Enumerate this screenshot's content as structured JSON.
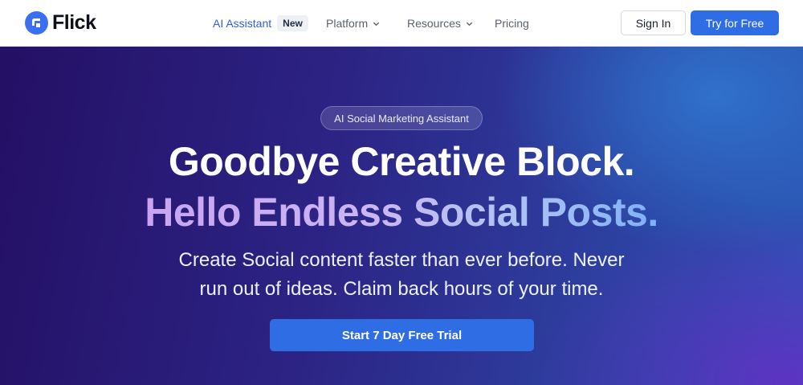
{
  "brand": {
    "name": "Flick",
    "icon": "flick-logo-icon",
    "accent": "#3b6ff2"
  },
  "nav": {
    "ai_assistant": "AI Assistant",
    "ai_badge": "New",
    "platform": "Platform",
    "resources": "Resources",
    "pricing": "Pricing"
  },
  "header_actions": {
    "sign_in": "Sign In",
    "try_free": "Try for Free"
  },
  "hero": {
    "badge": "AI Social Marketing Assistant",
    "headline_1": "Goodbye Creative Block.",
    "headline_2": "Hello Endless Social Posts.",
    "subtext_line_1": "Create Social content faster than ever before. Never",
    "subtext_line_2": "run out of ideas. Claim back hours of your time.",
    "cta": "Start 7 Day Free Trial"
  },
  "colors": {
    "primary_button": "#2f6de5",
    "link": "#2f5fd9"
  }
}
